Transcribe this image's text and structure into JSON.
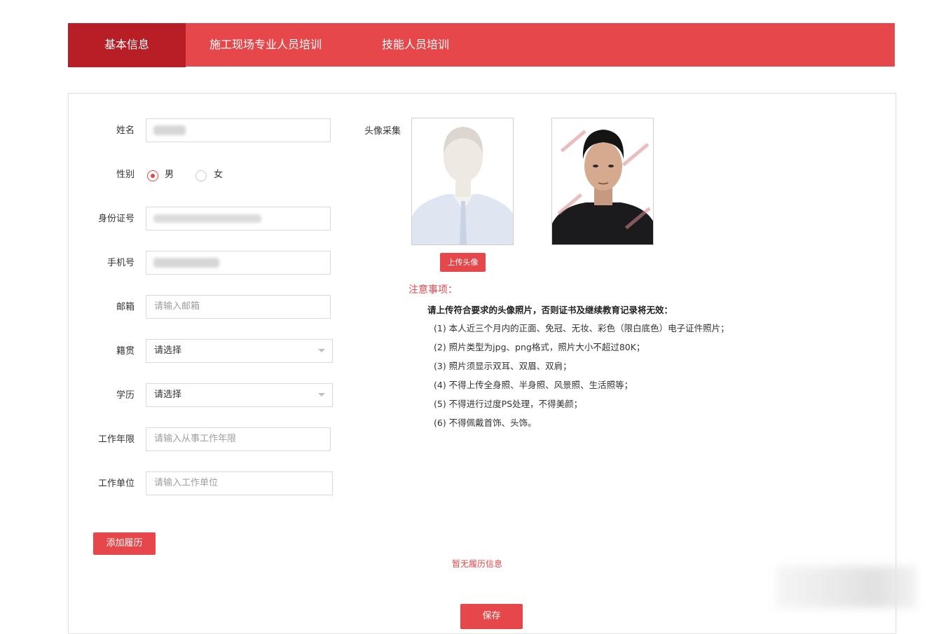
{
  "tabs": [
    {
      "label": "基本信息",
      "active": true
    },
    {
      "label": "施工现场专业人员培训",
      "active": false
    },
    {
      "label": "技能人员培训",
      "active": false
    }
  ],
  "form": {
    "name": {
      "label": "姓名",
      "value": ""
    },
    "gender": {
      "label": "性别",
      "options": [
        "男",
        "女"
      ],
      "selected": "男"
    },
    "id_number": {
      "label": "身份证号",
      "value": ""
    },
    "phone": {
      "label": "手机号",
      "value": ""
    },
    "email": {
      "label": "邮箱",
      "placeholder": "请输入邮箱"
    },
    "native_place": {
      "label": "籍贯",
      "selected": "请选择"
    },
    "education": {
      "label": "学历",
      "selected": "请选择"
    },
    "work_years": {
      "label": "工作年限",
      "placeholder": "请输入从事工作年限"
    },
    "work_unit": {
      "label": "工作单位",
      "placeholder": "请输入工作单位"
    }
  },
  "avatar": {
    "label": "头像采集",
    "upload_label": "上传头像"
  },
  "notice": {
    "title": "注意事项：",
    "bold": "请上传符合要求的头像照片，否则证书及继续教育记录将无效：",
    "items": [
      "(1) 本人近三个月内的正面、免冠、无妆、彩色（限白底色）电子证件照片；",
      "(2) 照片类型为jpg、png格式，照片大小不超过80K；",
      "(3) 照片须显示双耳、双眉、双肩；",
      "(4) 不得上传全身照、半身照、风景照、生活照等；",
      "(5) 不得进行过度PS处理，不得美颜；",
      "(6) 不得佩戴首饰、头饰。"
    ]
  },
  "resume": {
    "add_label": "添加履历",
    "empty_text": "暂无履历信息"
  },
  "save_label": "保存",
  "colors": {
    "accent": "#e5474a",
    "tab_active": "#b81e25"
  }
}
